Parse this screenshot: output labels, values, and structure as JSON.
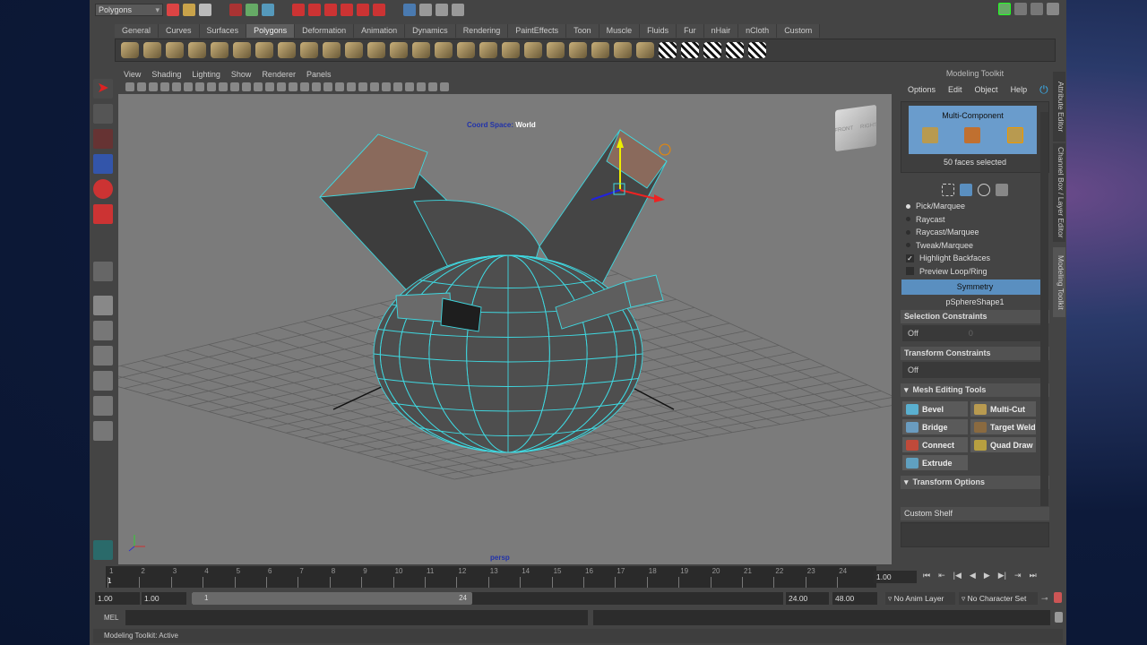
{
  "status_line": {
    "menu_set": "Polygons"
  },
  "shelf": {
    "tabs": [
      "General",
      "Curves",
      "Surfaces",
      "Polygons",
      "Deformation",
      "Animation",
      "Dynamics",
      "Rendering",
      "PaintEffects",
      "Toon",
      "Muscle",
      "Fluids",
      "Fur",
      "nHair",
      "nCloth",
      "Custom"
    ],
    "active_tab": "Polygons"
  },
  "viewport": {
    "menu": [
      "View",
      "Shading",
      "Lighting",
      "Show",
      "Renderer",
      "Panels"
    ],
    "hud_coord_label": "Coord Space:",
    "hud_coord_value": "World",
    "camera": "persp",
    "viewcube": {
      "front": "FRONT",
      "right": "RIGHT"
    }
  },
  "modeling_toolkit": {
    "title": "Modeling Toolkit",
    "menu": [
      "Options",
      "Edit",
      "Object",
      "Help"
    ],
    "mode": "Multi-Component",
    "selection_info": "50 faces selected",
    "pick_modes": [
      {
        "label": "Pick/Marquee",
        "selected": true
      },
      {
        "label": "Raycast",
        "selected": false
      },
      {
        "label": "Raycast/Marquee",
        "selected": false
      },
      {
        "label": "Tweak/Marquee",
        "selected": false
      }
    ],
    "highlight_backfaces": {
      "label": "Highlight Backfaces",
      "checked": true
    },
    "preview_loop": {
      "label": "Preview Loop/Ring",
      "checked": false
    },
    "symmetry_label": "Symmetry",
    "symmetry_object": "pSphereShape1",
    "selection_constraints": {
      "title": "Selection Constraints",
      "value": "Off",
      "number": "0"
    },
    "transform_constraints": {
      "title": "Transform Constraints",
      "value": "Off"
    },
    "mesh_editing_tools": {
      "title": "Mesh Editing Tools",
      "buttons": [
        "Bevel",
        "Multi-Cut",
        "Bridge",
        "Target Weld",
        "Connect",
        "Quad Draw",
        "Extrude"
      ]
    },
    "transform_options": {
      "title": "Transform Options"
    },
    "custom_shelf": "Custom Shelf"
  },
  "side_tabs": [
    "Attribute Editor",
    "Channel Box / Layer Editor",
    "Modeling Toolkit"
  ],
  "timeline": {
    "ticks": [
      "1",
      "2",
      "3",
      "4",
      "5",
      "6",
      "7",
      "8",
      "9",
      "10",
      "11",
      "12",
      "13",
      "14",
      "15",
      "16",
      "17",
      "18",
      "19",
      "20",
      "21",
      "22",
      "23",
      "24"
    ],
    "current_frame": "1",
    "current_time": "1.00"
  },
  "range": {
    "start": "1.00",
    "playback_start": "1.00",
    "slider_start": "1",
    "slider_end": "24",
    "playback_end": "24.00",
    "end": "48.00",
    "anim_layer": "No Anim Layer",
    "character_set": "No Character Set"
  },
  "command_line": {
    "label": "MEL"
  },
  "help_line": "Modeling Toolkit: Active",
  "colors": {
    "accent": "#6a9ccc",
    "wireframe": "#3fd8e0",
    "viewport_bg": "#7b7b7b"
  }
}
